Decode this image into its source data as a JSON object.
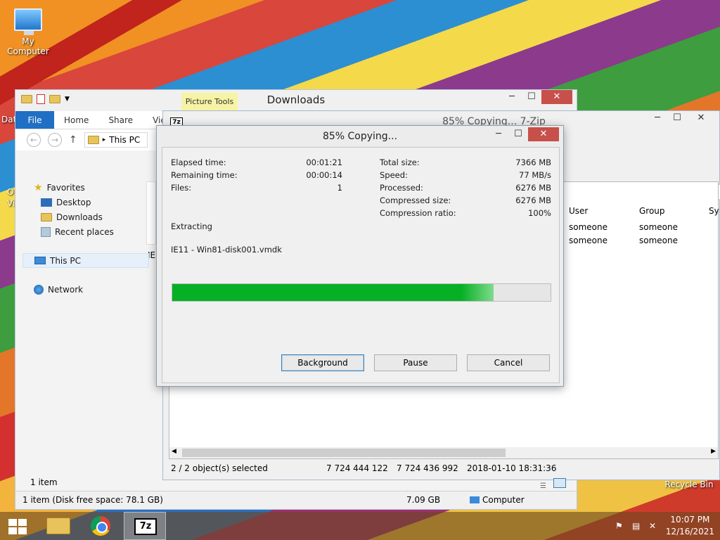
{
  "desktop": {
    "icons": [
      {
        "label": "My Computer"
      },
      {
        "label": "Recycle Bin"
      }
    ],
    "partial_labels": [
      "Dat",
      "O",
      "Vi"
    ]
  },
  "explorer": {
    "title": "Downloads",
    "picture_tools": "Picture Tools",
    "tabs": [
      "File",
      "Home",
      "Share",
      "Vie"
    ],
    "address": "This PC",
    "nav": {
      "favorites": "Favorites",
      "desktop": "Desktop",
      "downloads": "Downloads",
      "recent": "Recent places",
      "this_pc": "This PC",
      "network": "Network"
    },
    "content_partial": "IE1",
    "item_count": "1 item",
    "status": {
      "left": "1 item (Disk free space: 78.1 GB)",
      "size": "7.09 GB",
      "location": "Computer"
    }
  },
  "sevenzip": {
    "title": "85% Copying... 7-Zip",
    "logo": "7z",
    "columns": [
      "User",
      "Group",
      "Sy"
    ],
    "rows": [
      {
        "user": "someone",
        "group": "someone"
      },
      {
        "user": "someone",
        "group": "someone"
      }
    ],
    "status": {
      "selected": "2 / 2 object(s) selected",
      "size": "7 724 444 122",
      "packed": "7 724 436 992",
      "date": "2018-01-10 18:31:36"
    }
  },
  "copy_dialog": {
    "title": "85% Copying...",
    "left_stats": [
      {
        "label": "Elapsed time:",
        "value": "00:01:21"
      },
      {
        "label": "Remaining time:",
        "value": "00:00:14"
      },
      {
        "label": "Files:",
        "value": "1"
      }
    ],
    "right_stats": [
      {
        "label": "Total size:",
        "value": "7366 MB"
      },
      {
        "label": "Speed:",
        "value": "77 MB/s"
      },
      {
        "label": "Processed:",
        "value": "6276 MB"
      },
      {
        "label": "Compressed size:",
        "value": "6276 MB"
      },
      {
        "label": "Compression ratio:",
        "value": "100%"
      }
    ],
    "operation": "Extracting",
    "filename": "IE11 - Win81-disk001.vmdk",
    "progress": 0.85,
    "buttons": {
      "background": "Background",
      "pause": "Pause",
      "cancel": "Cancel"
    }
  },
  "taskbar": {
    "apps": [
      "start-button",
      "file-explorer",
      "chrome",
      "7-zip"
    ],
    "clock_time": "10:07 PM",
    "clock_date": "12/16/2021"
  }
}
